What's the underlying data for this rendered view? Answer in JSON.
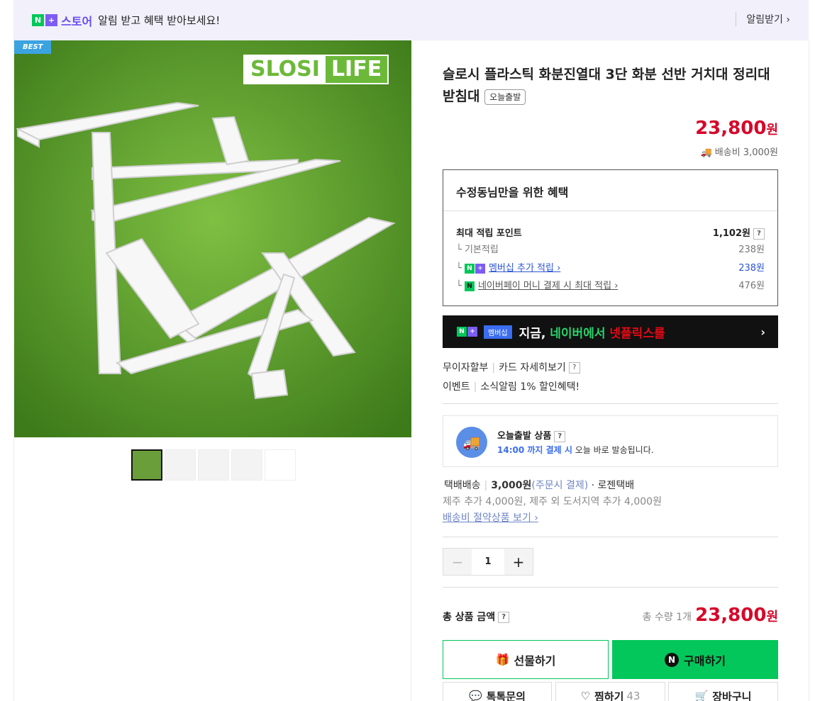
{
  "topbar": {
    "brand_n": "N",
    "brand_plus": "+",
    "store": "스토어",
    "message": "알림 받고 혜택 받아보세요!",
    "alarm": "알림받기 ›"
  },
  "gallery": {
    "badge": "BEST",
    "logo_part1": "SLOSI",
    "logo_part2": "LIFE",
    "thumb_count": 5
  },
  "product": {
    "title": "슬로시 플라스틱 화분진열대 3단 화분 선반 거치대 정리대 받침대",
    "today_tag": "오늘출발",
    "price": "23,800",
    "price_unit": "원",
    "shipping": "배송비 3,000원"
  },
  "benefit": {
    "heading": "수정동님만을 위한 혜택",
    "max_label": "최대 적립 포인트",
    "max_value": "1,102원",
    "q": "?",
    "rows": [
      {
        "label": "기본적립",
        "value": "238원"
      },
      {
        "label": "멤버십 추가 적립 ›",
        "value": "238원"
      },
      {
        "label": "네이버페이 머니 결제 시 최대 적립 ›",
        "value": "476원"
      }
    ]
  },
  "banner": {
    "mem": "멤버십",
    "text1": "지금, ",
    "text2": "네이버에서 ",
    "text3": "넷플릭스를",
    "arrow": "›"
  },
  "payment": {
    "item1": "무이자할부",
    "item2": "카드 자세히보기",
    "item3": "이벤트",
    "item4": "소식알림 1% 할인혜택!"
  },
  "today": {
    "title": "오늘출발 상품",
    "time": "14:00 까지 결제 시",
    "desc": " 오늘 바로 발송됩니다."
  },
  "delivery": {
    "type": "택배배송",
    "fee": "3,000원",
    "fee_note": "(주문시 결제)",
    "carrier": "· 로젠택배",
    "extra": "제주 추가 4,000원, 제주 외 도서지역 추가 4,000원",
    "save_link": "배송비 절약상품 보기 ›"
  },
  "quantity": {
    "minus": "−",
    "value": "1",
    "plus": "+"
  },
  "total": {
    "label": "총 상품 금액",
    "qty": "총 수량 1개",
    "price": "23,800",
    "unit": "원"
  },
  "actions": {
    "gift": "선물하기",
    "buy": "구매하기",
    "talk": "톡톡문의",
    "wish": "찜하기",
    "wish_count": "43",
    "cart": "장바구니"
  }
}
